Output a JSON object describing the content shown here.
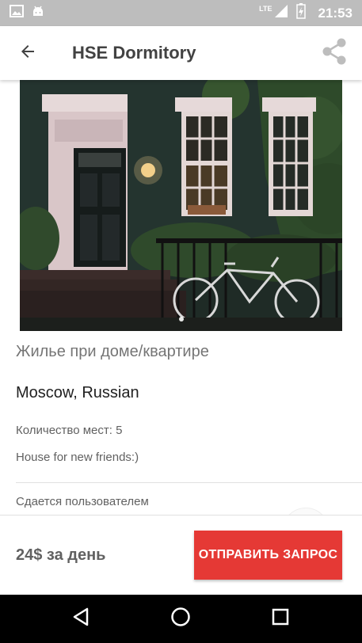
{
  "status_bar": {
    "time": "21:53",
    "network": "LTE",
    "icons": [
      "image-icon",
      "android-icon",
      "lte-signal-icon",
      "battery-icon"
    ]
  },
  "app_bar": {
    "title": "HSE Dormitory",
    "back_icon": "arrow-left-icon",
    "share_icon": "share-icon"
  },
  "listing": {
    "photo_count": 1,
    "active_photo": 1,
    "property_type": "Жилье при доме/квартире",
    "location": "Moscow, Russian",
    "capacity": "Количество мест: 5",
    "description": "House for new friends:)",
    "host_label": "Сдается пользователем"
  },
  "booking": {
    "price": "24$ за день",
    "request_button": "ОТПРАВИТЬ ЗАПРОС",
    "accent_color": "#e53935"
  },
  "nav_bar": {
    "icons": [
      "back-triangle-icon",
      "home-circle-icon",
      "recents-square-icon"
    ]
  }
}
